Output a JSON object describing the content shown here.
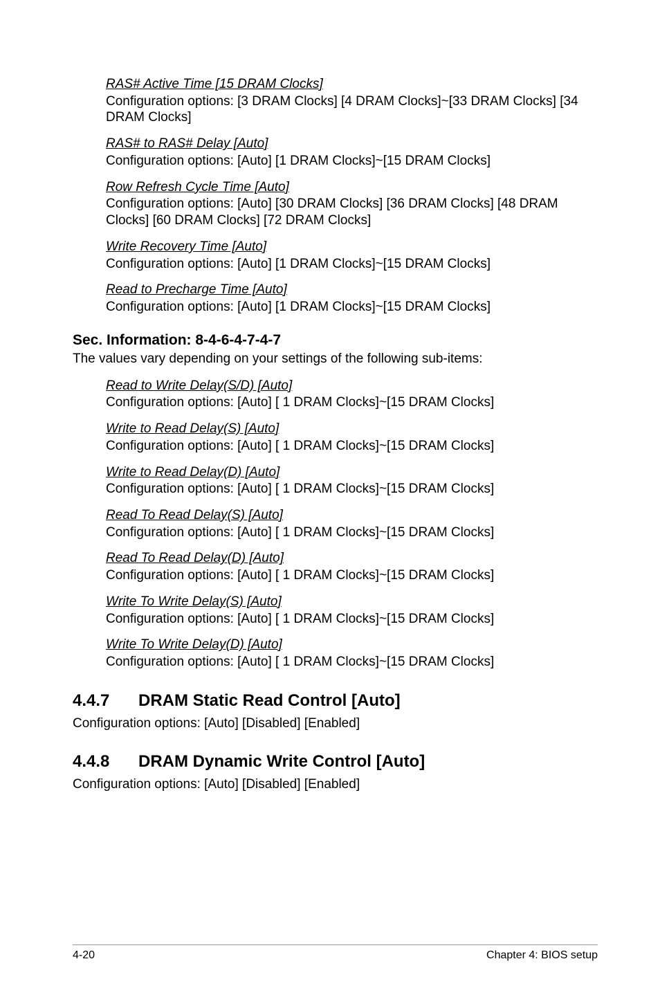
{
  "primary": {
    "settings": [
      {
        "title": "RAS# Active Time [15 DRAM Clocks]",
        "desc": "Configuration options: [3 DRAM Clocks] [4 DRAM Clocks]~[33 DRAM Clocks] [34 DRAM Clocks]"
      },
      {
        "title": "RAS# to RAS# Delay [Auto]",
        "desc": "Configuration options: [Auto] [1 DRAM Clocks]~[15 DRAM Clocks]"
      },
      {
        "title": "Row Refresh Cycle Time [Auto]",
        "desc": "Configuration options: [Auto] [30 DRAM Clocks] [36 DRAM Clocks] [48 DRAM Clocks] [60 DRAM Clocks] [72 DRAM Clocks]"
      },
      {
        "title": "Write Recovery Time [Auto]",
        "desc": "Configuration options: [Auto] [1 DRAM Clocks]~[15 DRAM Clocks]"
      },
      {
        "title": "Read to Precharge Time [Auto]",
        "desc": "Configuration options: [Auto] [1 DRAM Clocks]~[15 DRAM Clocks]"
      }
    ]
  },
  "secSection": {
    "heading": "Sec. Information: 8-4-6-4-7-4-7",
    "intro": "The values vary depending on your settings of the following sub-items:",
    "settings": [
      {
        "title": "Read to Write Delay(S/D) [Auto]",
        "desc": "Configuration options: [Auto] [ 1 DRAM Clocks]~[15 DRAM Clocks]"
      },
      {
        "title": "Write to Read Delay(S) [Auto]",
        "desc": "Configuration options: [Auto] [ 1 DRAM Clocks]~[15 DRAM Clocks]"
      },
      {
        "title": "Write to Read Delay(D) [Auto]",
        "desc": "Configuration options: [Auto] [ 1 DRAM Clocks]~[15 DRAM Clocks]"
      },
      {
        "title": "Read To Read Delay(S) [Auto]",
        "desc": "Configuration options: [Auto] [ 1 DRAM Clocks]~[15 DRAM Clocks]"
      },
      {
        "title": "Read To Read Delay(D) [Auto]",
        "desc": "Configuration options: [Auto] [ 1 DRAM Clocks]~[15 DRAM Clocks]"
      },
      {
        "title": "Write To Write Delay(S) [Auto]",
        "desc": "Configuration options: [Auto] [ 1 DRAM Clocks]~[15 DRAM Clocks]"
      },
      {
        "title": "Write To Write Delay(D) [Auto]",
        "desc": "Configuration options: [Auto] [ 1 DRAM Clocks]~[15 DRAM Clocks]"
      }
    ]
  },
  "numbered": [
    {
      "num": "4.4.7",
      "title": "DRAM Static Read Control [Auto]",
      "desc": "Configuration options: [Auto] [Disabled] [Enabled]"
    },
    {
      "num": "4.4.8",
      "title": "DRAM Dynamic Write Control [Auto]",
      "desc": "Configuration options: [Auto] [Disabled] [Enabled]"
    }
  ],
  "footer": {
    "pageNum": "4-20",
    "chapter": "Chapter 4: BIOS setup"
  }
}
